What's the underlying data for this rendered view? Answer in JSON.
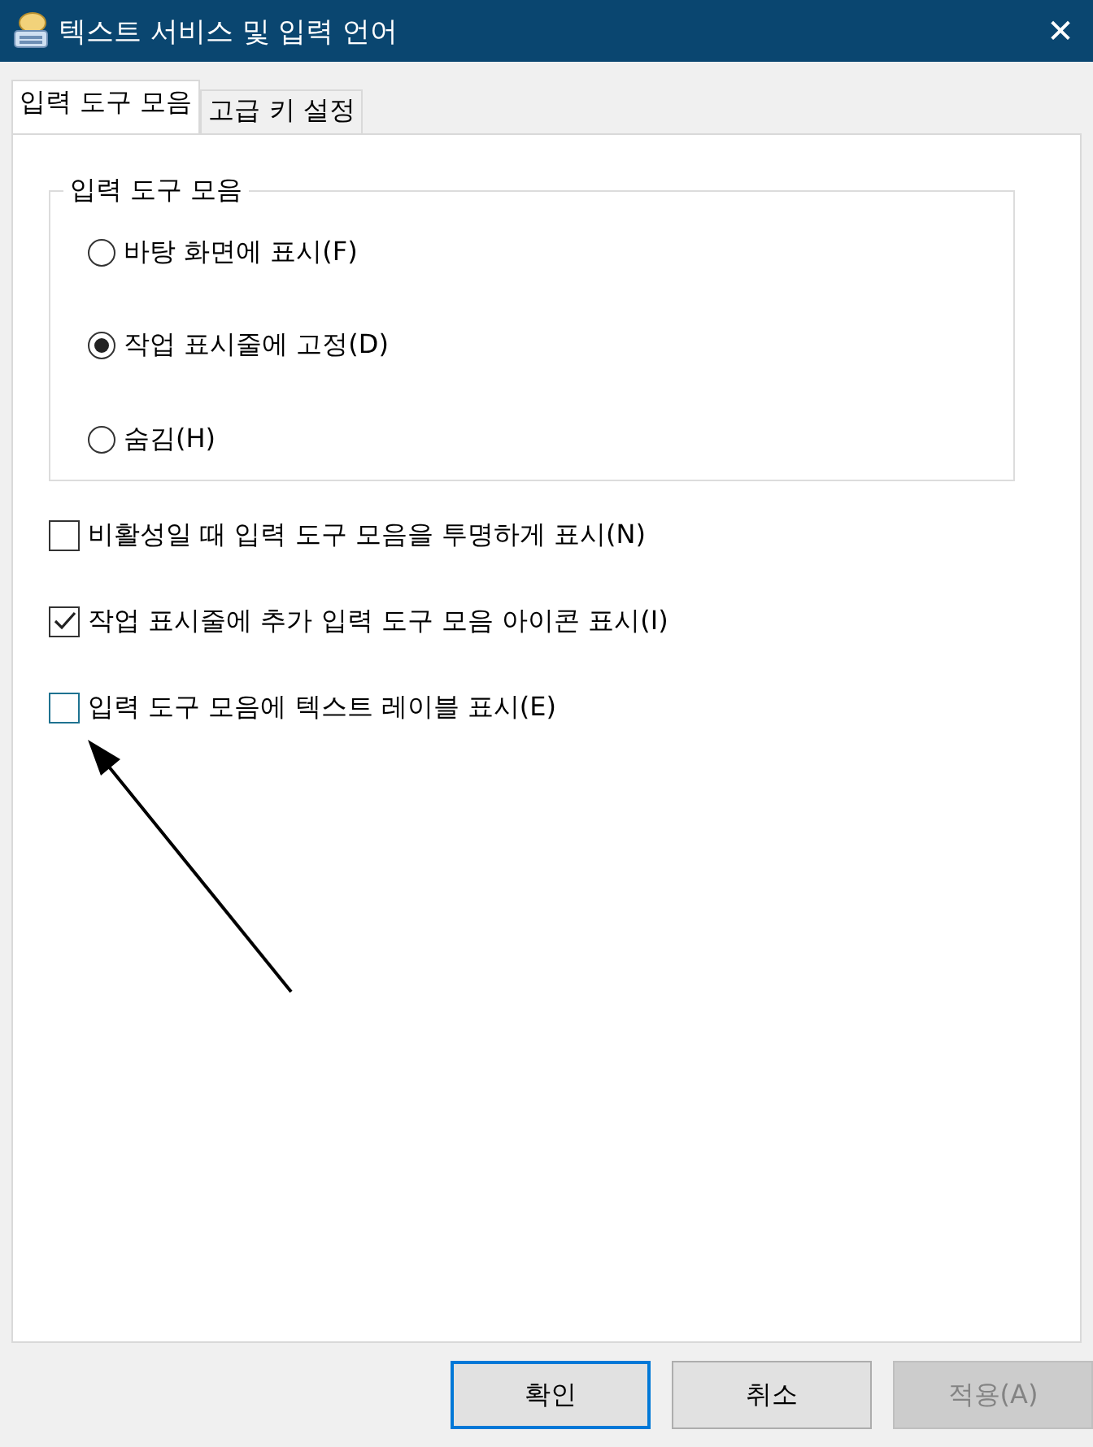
{
  "window": {
    "title": "텍스트 서비스 및 입력 언어",
    "close": "✕"
  },
  "tabs": [
    {
      "label": "입력 도구 모음",
      "selected": true
    },
    {
      "label": "고급 키 설정",
      "selected": false
    }
  ],
  "group": {
    "title": "입력 도구 모음",
    "options": [
      {
        "label": "바탕 화면에 표시(F)",
        "selected": false
      },
      {
        "label": "작업 표시줄에 고정(D)",
        "selected": true
      },
      {
        "label": "숨김(H)",
        "selected": false
      }
    ]
  },
  "checkboxes": [
    {
      "label": "비활성일 때 입력 도구 모음을 투명하게 표시(N)",
      "checked": false,
      "focused": false
    },
    {
      "label": "작업 표시줄에 추가 입력 도구 모음 아이콘 표시(I)",
      "checked": true,
      "focused": false
    },
    {
      "label": "입력 도구 모음에 텍스트 레이블 표시(E)",
      "checked": false,
      "focused": true
    }
  ],
  "buttons": [
    {
      "label": "확인",
      "default": true,
      "disabled": false
    },
    {
      "label": "취소",
      "default": false,
      "disabled": false
    },
    {
      "label": "적용(A)",
      "default": false,
      "disabled": true
    }
  ]
}
